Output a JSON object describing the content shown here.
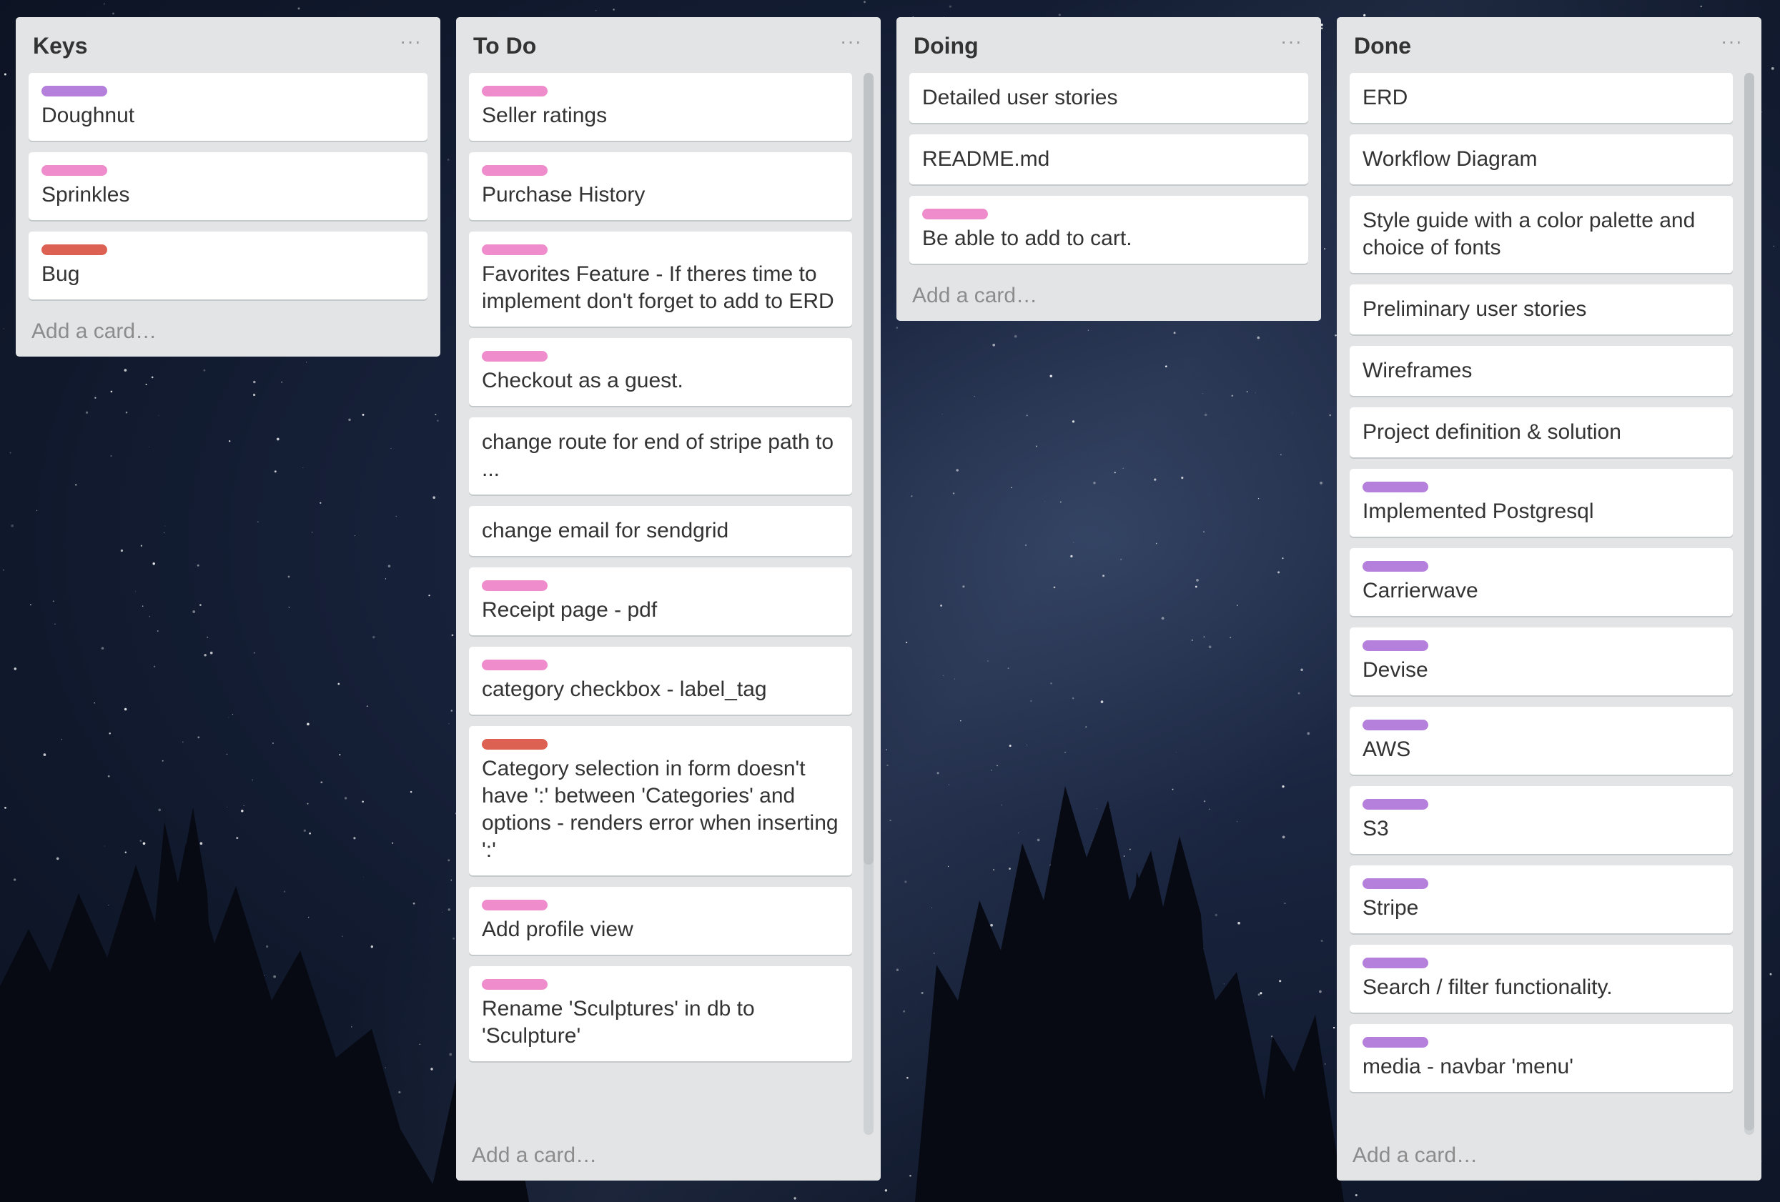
{
  "colors": {
    "purple": "#b57fdc",
    "pink": "#ef8ccc",
    "red": "#dd6153"
  },
  "lists": [
    {
      "title": "Keys",
      "menu": "···",
      "add_card": "Add a card…",
      "cards": [
        {
          "label": "purple",
          "text": "Doughnut"
        },
        {
          "label": "pink",
          "text": "Sprinkles"
        },
        {
          "label": "red",
          "text": "Bug"
        }
      ]
    },
    {
      "title": "To Do",
      "menu": "···",
      "add_card": "Add a card…",
      "cards": [
        {
          "label": "pink",
          "text": "Seller ratings"
        },
        {
          "label": "pink",
          "text": "Purchase History"
        },
        {
          "label": "pink",
          "text": "Favorites Feature - If theres time to implement don't forget to add to ERD"
        },
        {
          "label": "pink",
          "text": "Checkout as a guest."
        },
        {
          "label": null,
          "text": "change route for end of stripe path to ..."
        },
        {
          "label": null,
          "text": "change email for sendgrid"
        },
        {
          "label": "pink",
          "text": "Receipt page - pdf"
        },
        {
          "label": "pink",
          "text": "category checkbox - label_tag"
        },
        {
          "label": "red",
          "text": "Category selection in form doesn't have ':' between 'Categories' and options - renders error when inserting ':'"
        },
        {
          "label": "pink",
          "text": "Add profile view"
        },
        {
          "label": "pink",
          "text": "Rename 'Sculptures' in db to 'Sculpture'"
        }
      ]
    },
    {
      "title": "Doing",
      "menu": "···",
      "add_card": "Add a card…",
      "cards": [
        {
          "label": null,
          "text": "Detailed user stories"
        },
        {
          "label": null,
          "text": "README.md"
        },
        {
          "label": "pink",
          "text": "Be able to add to cart."
        }
      ]
    },
    {
      "title": "Done",
      "menu": "···",
      "add_card": "Add a card…",
      "cards": [
        {
          "label": null,
          "text": "ERD"
        },
        {
          "label": null,
          "text": "Workflow Diagram"
        },
        {
          "label": null,
          "text": "Style guide with a color palette and choice of fonts"
        },
        {
          "label": null,
          "text": "Preliminary user stories"
        },
        {
          "label": null,
          "text": "Wireframes"
        },
        {
          "label": null,
          "text": "Project definition & solution"
        },
        {
          "label": "purple",
          "text": "Implemented Postgresql"
        },
        {
          "label": "purple",
          "text": "Carrierwave"
        },
        {
          "label": "purple",
          "text": "Devise"
        },
        {
          "label": "purple",
          "text": "AWS"
        },
        {
          "label": "purple",
          "text": "S3"
        },
        {
          "label": "purple",
          "text": "Stripe"
        },
        {
          "label": "purple",
          "text": "Search / filter functionality."
        },
        {
          "label": "purple",
          "text": "media - navbar 'menu'"
        }
      ]
    }
  ]
}
